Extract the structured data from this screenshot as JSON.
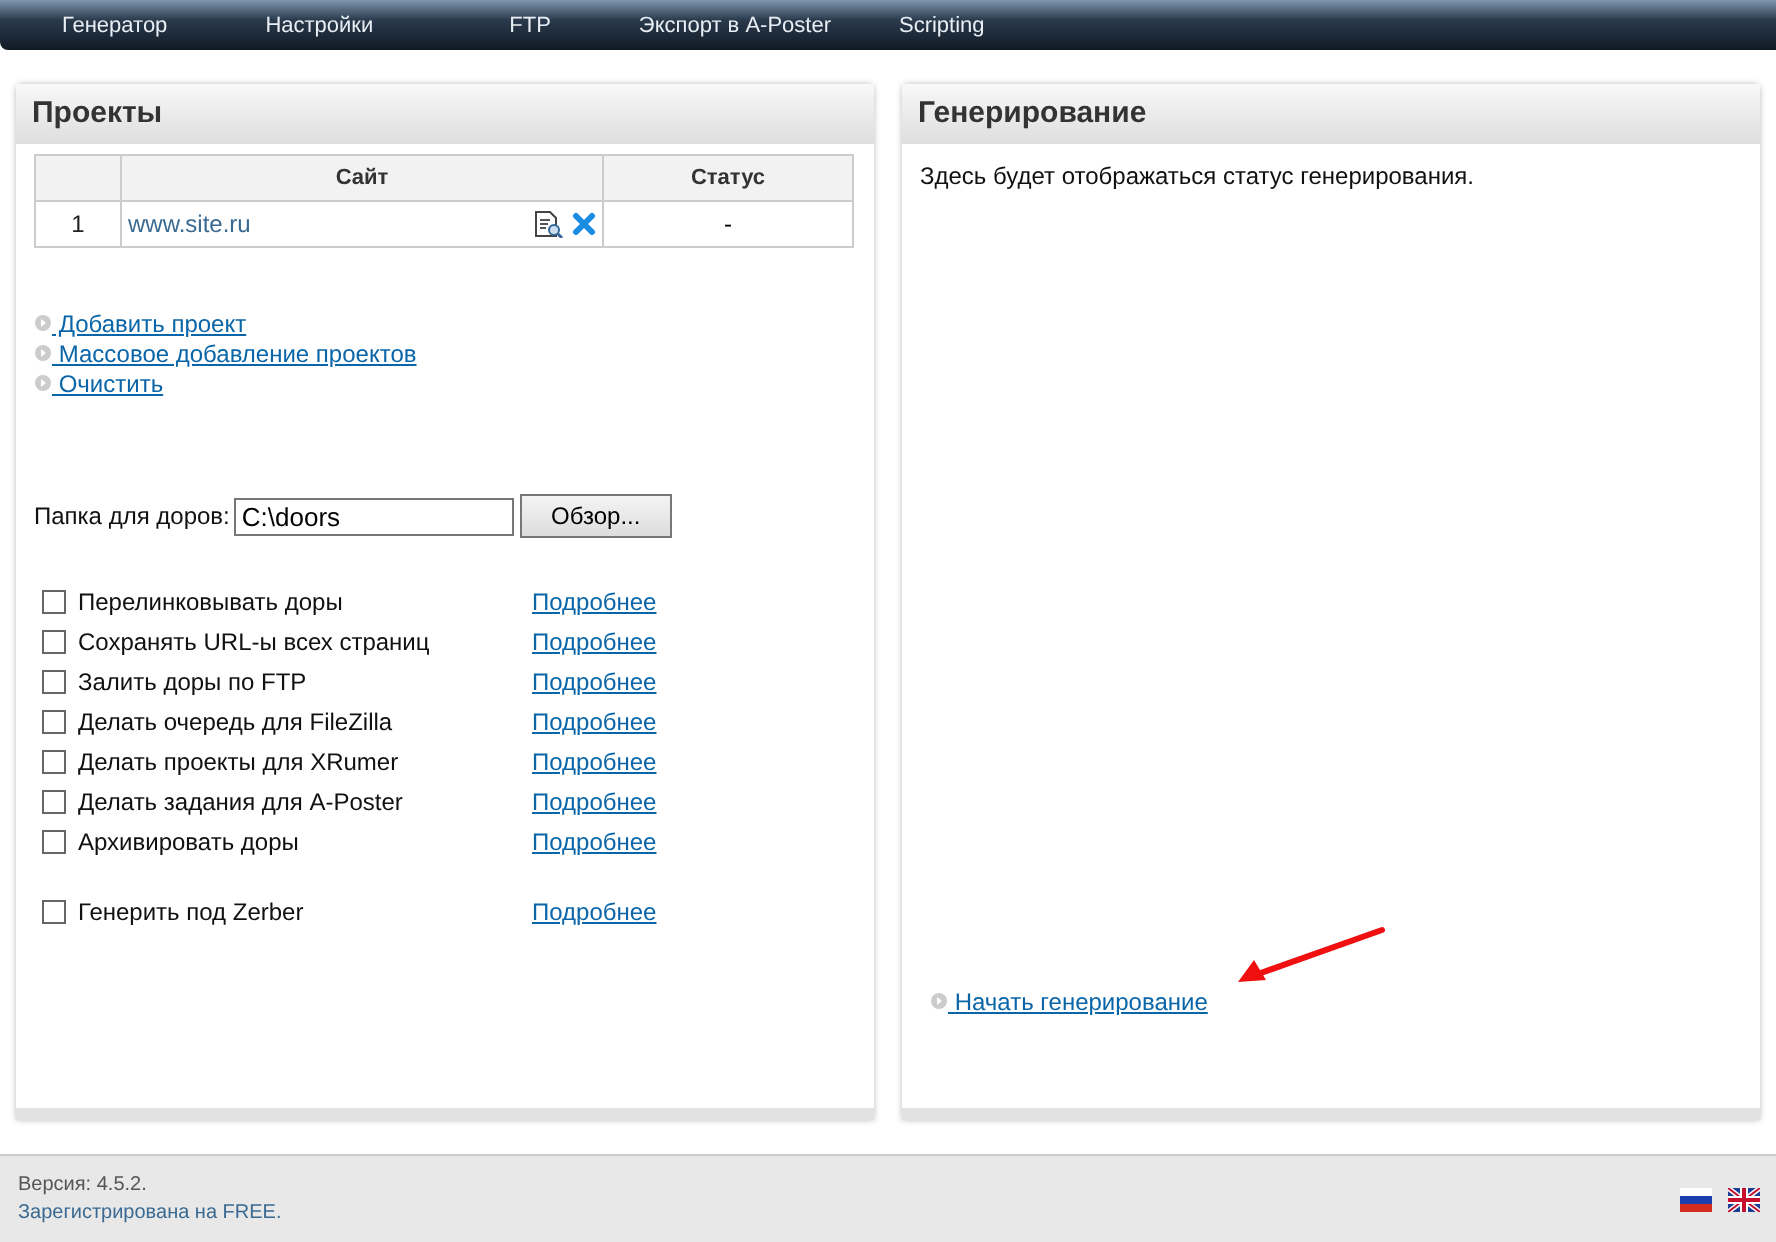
{
  "nav": [
    {
      "label": "Генератор"
    },
    {
      "label": "Настройки"
    },
    {
      "label": "FTP"
    },
    {
      "label": "Экспорт в A-Poster"
    },
    {
      "label": "Scripting"
    }
  ],
  "projects": {
    "title": "Проекты",
    "table": {
      "columns": [
        "Сайт",
        "Статус"
      ],
      "rows": [
        {
          "number": "1",
          "site": "www.site.ru",
          "status": "-"
        }
      ]
    },
    "links": [
      "Добавить проект",
      "Массовое добавление проектов",
      "Очистить"
    ],
    "folder": {
      "label": "Папка для доров:",
      "value": "C:\\doors",
      "button": "Обзор..."
    },
    "option_groups": [
      {
        "options": [
          {
            "label": "Перелинковывать доры",
            "checked": false,
            "more": "Подробнее"
          },
          {
            "label": "Сохранять URL-ы всех страниц",
            "checked": false,
            "more": "Подробнее"
          },
          {
            "label": "Залить доры по FTP",
            "checked": false,
            "more": "Подробнее"
          },
          {
            "label": "Делать очередь для FileZilla",
            "checked": false,
            "more": "Подробнее"
          },
          {
            "label": "Делать проекты для XRumer",
            "checked": false,
            "more": "Подробнее"
          },
          {
            "label": "Делать задания для A-Poster",
            "checked": false,
            "more": "Подробнее"
          },
          {
            "label": "Архивировать доры",
            "checked": false,
            "more": "Подробнее"
          }
        ]
      },
      {
        "options": [
          {
            "label": "Генерить под Zerber",
            "checked": false,
            "more": "Подробнее"
          }
        ]
      }
    ]
  },
  "generation": {
    "title": "Генерирование",
    "status_text": "Здесь будет отображаться статус генерирования.",
    "start_link": "Начать генерирование"
  },
  "footer": {
    "version": "Версия: 4.5.2.",
    "registration": "Зарегистрирована на FREE."
  }
}
